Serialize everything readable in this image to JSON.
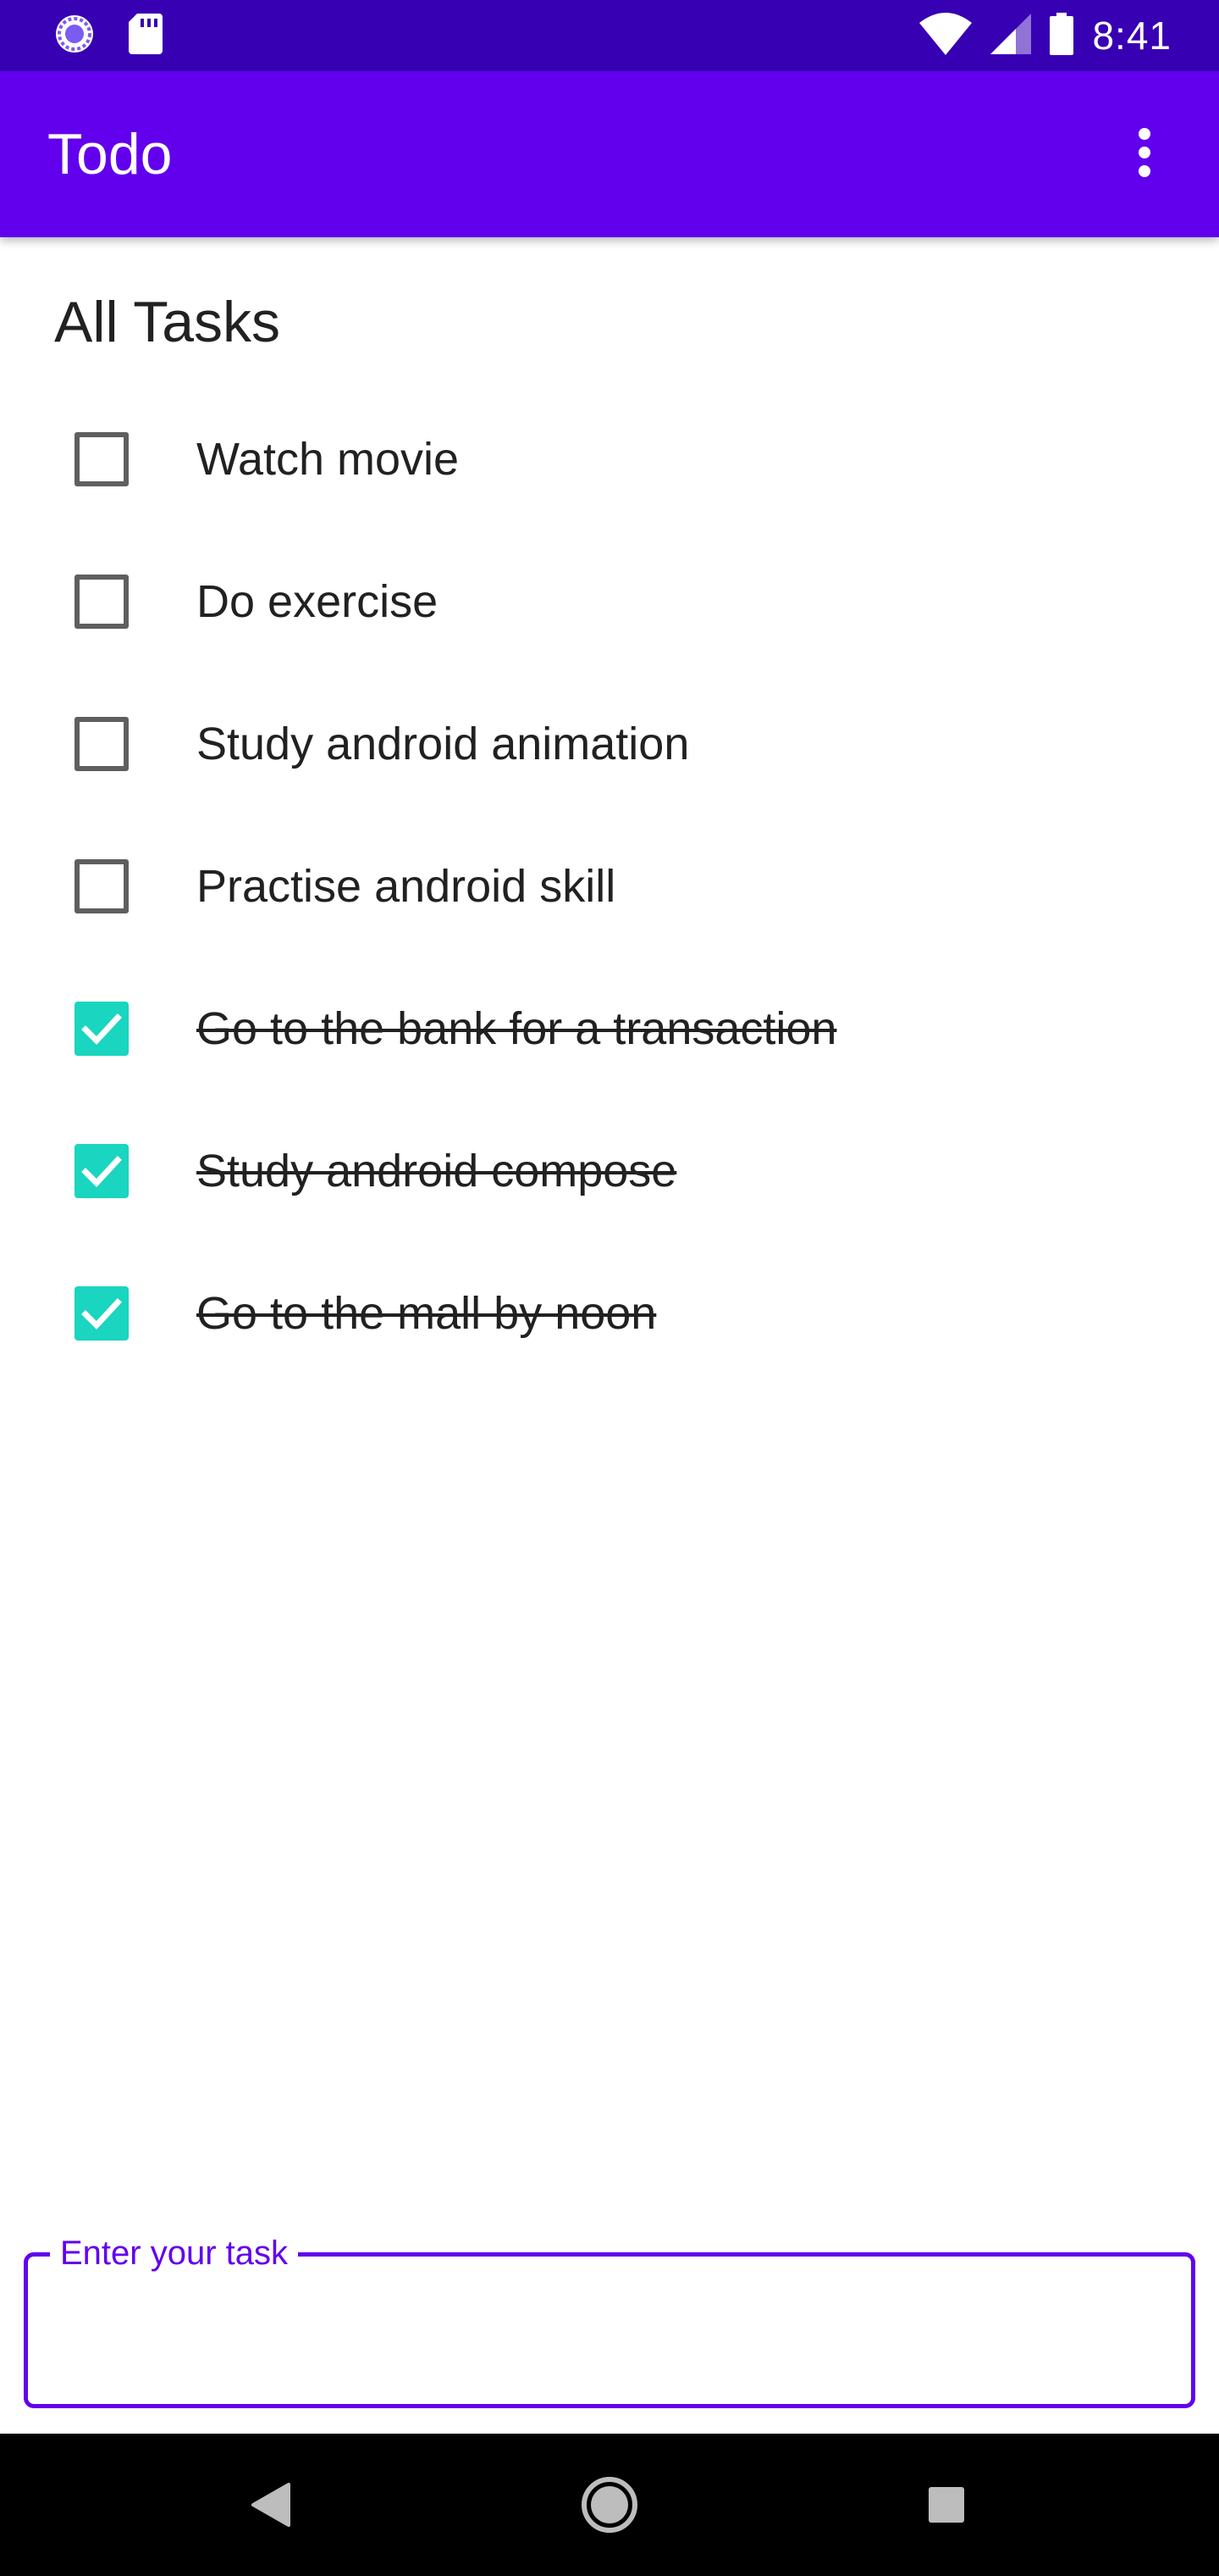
{
  "status_bar": {
    "time": "8:41",
    "left_icons": [
      "sync-icon",
      "sd-card-icon"
    ],
    "right_icons": [
      "wifi-icon",
      "cell-signal-icon",
      "battery-icon"
    ]
  },
  "app_bar": {
    "title": "Todo",
    "menu_icon": "more-vert-icon"
  },
  "section": {
    "title": "All Tasks"
  },
  "tasks": [
    {
      "label": "Watch movie",
      "done": false
    },
    {
      "label": "Do exercise",
      "done": false
    },
    {
      "label": "Study android animation",
      "done": false
    },
    {
      "label": "Practise android skill",
      "done": false
    },
    {
      "label": "Go to the bank for a transaction",
      "done": true
    },
    {
      "label": "Study android compose",
      "done": true
    },
    {
      "label": "Go to the mall by noon",
      "done": true
    }
  ],
  "input": {
    "label": "Enter your task",
    "value": ""
  },
  "nav_bar": {
    "buttons": [
      "back-icon",
      "home-icon",
      "recents-icon"
    ]
  },
  "colors": {
    "status_bar": "#3700b3",
    "app_bar": "#6200ee",
    "checkbox_checked": "#1ad5bf",
    "text": "#212121"
  }
}
